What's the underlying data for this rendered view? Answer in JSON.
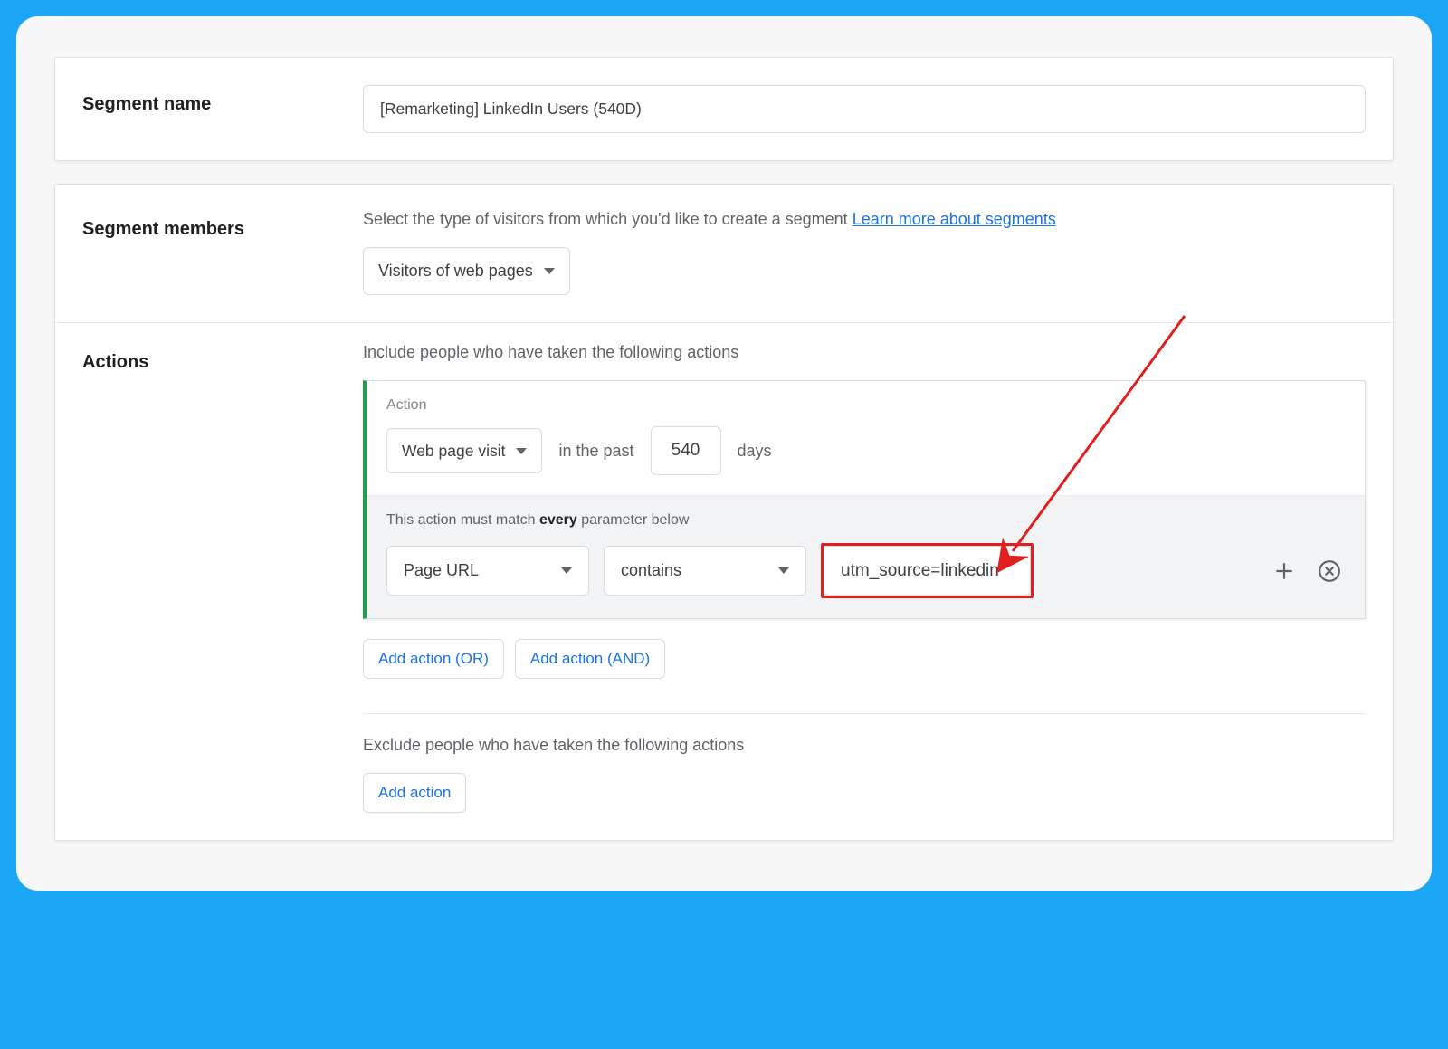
{
  "segment_name": {
    "label": "Segment name",
    "value": "[Remarketing] LinkedIn Users (540D)"
  },
  "segment_members": {
    "label": "Segment members",
    "description": "Select the type of visitors from which you'd like to create a segment ",
    "learn_more": "Learn more about segments",
    "dropdown_selected": "Visitors of web pages"
  },
  "actions": {
    "label": "Actions",
    "include_title": "Include people who have taken the following actions",
    "action_block": {
      "label": "Action",
      "type_selected": "Web page visit",
      "past_text": "in the past",
      "days_value": "540",
      "days_label": "days",
      "param_title_prefix": "This action must match ",
      "param_title_bold": "every",
      "param_title_suffix": " parameter below",
      "param_field": "Page URL",
      "param_operator": "contains",
      "param_value": "utm_source=linkedin"
    },
    "add_action_or": "Add action (OR)",
    "add_action_and": "Add action (AND)",
    "exclude_title": "Exclude people who have taken the following actions",
    "add_action": "Add action"
  }
}
